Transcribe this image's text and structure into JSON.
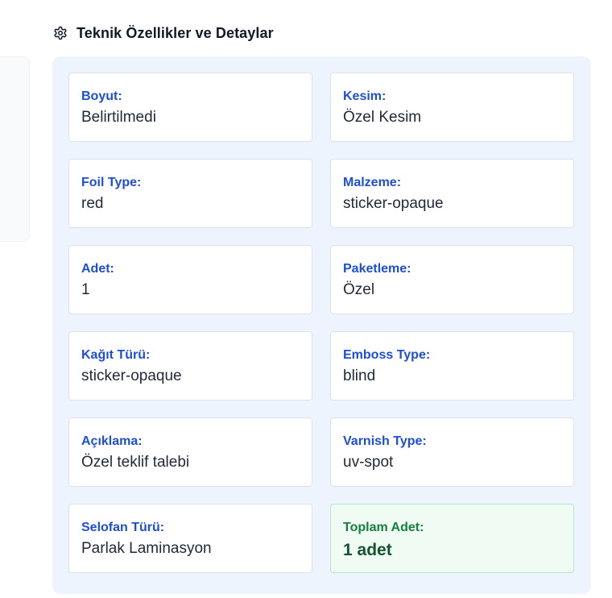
{
  "section": {
    "title": "Teknik Özellikler ve Detaylar",
    "icon": "gear-icon"
  },
  "details": [
    {
      "label": "Boyut:",
      "value": "Belirtilmedi"
    },
    {
      "label": "Kesim:",
      "value": "Özel Kesim"
    },
    {
      "label": "Foil Type:",
      "value": "red"
    },
    {
      "label": "Malzeme:",
      "value": "sticker-opaque"
    },
    {
      "label": "Adet:",
      "value": "1"
    },
    {
      "label": "Paketleme:",
      "value": "Özel"
    },
    {
      "label": "Kağıt Türü:",
      "value": "sticker-opaque"
    },
    {
      "label": "Emboss Type:",
      "value": "blind"
    },
    {
      "label": "Açıklama:",
      "value": "Özel teklif talebi"
    },
    {
      "label": "Varnish Type:",
      "value": "uv-spot"
    },
    {
      "label": "Selofan Türü:",
      "value": "Parlak Laminasyon"
    }
  ],
  "total": {
    "label": "Toplam Adet:",
    "value": "1 adet"
  },
  "colors": {
    "label_blue": "#1d4ed8",
    "panel_bg": "#eef4fd",
    "total_green": "#15803d",
    "total_bg": "#f0fbf3"
  }
}
